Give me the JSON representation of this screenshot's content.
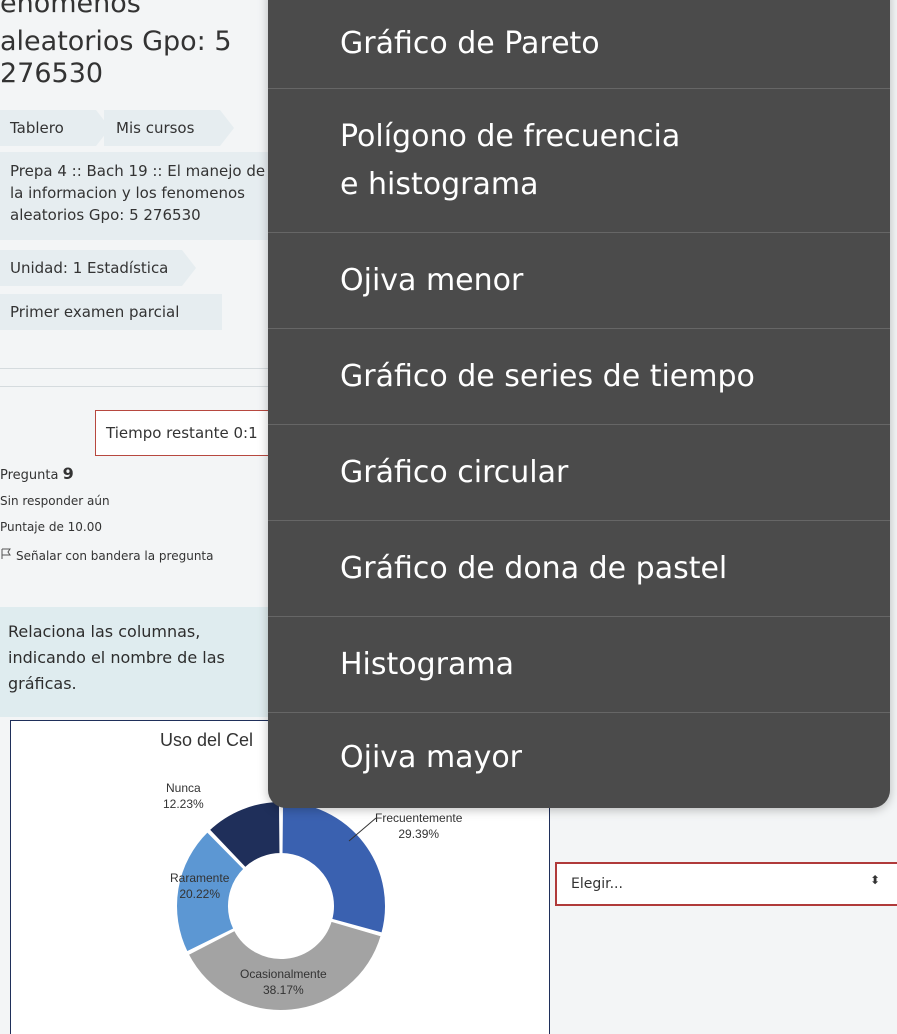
{
  "page": {
    "title_lines": [
      "enómenos",
      "aleatorios Gpo: 5",
      "276530"
    ]
  },
  "breadcrumb": {
    "items": [
      "Tablero",
      "Mis cursos"
    ],
    "course": [
      "Prepa 4 :: Bach 19 :: El manejo de",
      "la informacion y los fenomenos",
      "aleatorios Gpo: 5 276530"
    ],
    "unit": "Unidad: 1 Estadística",
    "exam": "Primer examen parcial"
  },
  "timer": {
    "label": "Tiempo restante 0:1"
  },
  "question": {
    "label": "Pregunta",
    "number": "9",
    "status": "Sin responder aún",
    "score": "Puntaje de 10.00",
    "flag_label": "Señalar con bandera la pregunta",
    "text": [
      "Relaciona las columnas,",
      "indicando el nombre de las",
      "gráficas."
    ]
  },
  "chart": {
    "title": "Uso del Cel"
  },
  "chart_data": {
    "type": "pie",
    "title": "Uso del Cel",
    "categories": [
      "Frecuentemente",
      "Ocasionalmente",
      "Raramente",
      "Nunca"
    ],
    "values": [
      29.39,
      38.17,
      20.22,
      12.23
    ],
    "labels": [
      "29.39%",
      "38.17%",
      "20.22%",
      "12.23%"
    ],
    "colors": [
      "#3a61b0",
      "#a3a3a3",
      "#5c97d3",
      "#1f2f5a"
    ],
    "donut": true
  },
  "select": {
    "value": "Elegir...",
    "arrow": "⬍"
  },
  "dropdown": {
    "options": [
      [
        "Gráfico de Pareto"
      ],
      [
        "Polígono de frecuencia",
        "e histograma"
      ],
      [
        "Ojiva menor"
      ],
      [
        "Gráfico de series de tiempo"
      ],
      [
        "Gráfico circular"
      ],
      [
        "Gráfico de dona de pastel"
      ],
      [
        "Histograma"
      ],
      [
        "Ojiva mayor"
      ]
    ]
  }
}
